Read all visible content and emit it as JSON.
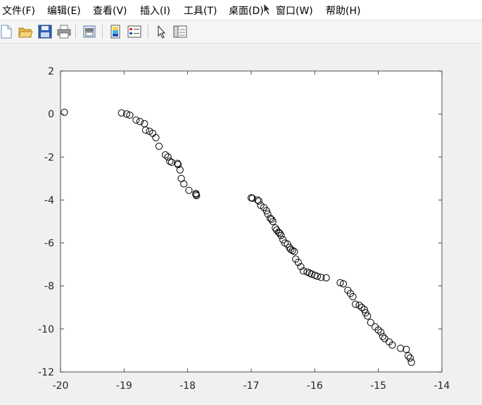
{
  "menubar": {
    "items": [
      {
        "label": "文件(F)"
      },
      {
        "label": "编辑(E)"
      },
      {
        "label": "查看(V)"
      },
      {
        "label": "插入(I)"
      },
      {
        "label": "工具(T)"
      },
      {
        "label": "桌面(D)"
      },
      {
        "label": "窗口(W)"
      },
      {
        "label": "帮助(H)"
      }
    ]
  },
  "toolbar": {
    "buttons": [
      {
        "icon": "new-figure-icon"
      },
      {
        "icon": "open-file-icon"
      },
      {
        "icon": "save-icon"
      },
      {
        "icon": "print-icon"
      },
      {
        "icon": "print-preview-icon"
      },
      {
        "icon": "insert-colorbar-icon"
      },
      {
        "icon": "insert-legend-icon"
      },
      {
        "icon": "edit-plot-arrow-icon"
      },
      {
        "icon": "property-inspector-icon"
      }
    ]
  },
  "chart_data": {
    "type": "scatter",
    "title": "",
    "xlabel": "",
    "ylabel": "",
    "xlim": [
      -20,
      -14
    ],
    "ylim": [
      -12,
      2
    ],
    "x_ticks": [
      "-20",
      "-19",
      "-18",
      "-17",
      "-16",
      "-15",
      "-14"
    ],
    "y_ticks": [
      "2",
      "0",
      "-2",
      "-4",
      "-6",
      "-8",
      "-10",
      "-12"
    ],
    "grid": false,
    "marker": "open-circle",
    "marker_color": "#000000",
    "series": [
      {
        "x": [
          -19.94,
          -19.04,
          -18.96,
          -18.91,
          -18.81,
          -18.75,
          -18.68,
          -18.66,
          -18.6,
          -18.55,
          -18.5,
          -18.45,
          -18.35,
          -18.31,
          -18.28,
          -18.25,
          -18.16,
          -18.15,
          -18.12,
          -18.1,
          -18.06,
          -17.98,
          -17.87,
          -17.87,
          -17.86
        ],
        "y": [
          0.08,
          0.05,
          0.0,
          -0.05,
          -0.28,
          -0.35,
          -0.45,
          -0.75,
          -0.8,
          -0.9,
          -1.1,
          -1.5,
          -1.9,
          -2.0,
          -2.2,
          -2.25,
          -2.3,
          -2.35,
          -2.6,
          -3.0,
          -3.25,
          -3.55,
          -3.7,
          -3.75,
          -3.8
        ]
      },
      {
        "x": [
          -17.0,
          -16.98,
          -16.9,
          -16.88,
          -16.85,
          -16.8,
          -16.76,
          -16.74,
          -16.7,
          -16.68,
          -16.66,
          -16.62,
          -16.6,
          -16.57,
          -16.55,
          -16.53,
          -16.5,
          -16.47,
          -16.43,
          -16.4,
          -16.38,
          -16.35,
          -16.32,
          -16.3,
          -16.26,
          -16.22,
          -16.18,
          -16.12,
          -16.08,
          -16.05,
          -16.0,
          -15.96,
          -15.9,
          -15.82
        ],
        "y": [
          -3.9,
          -3.92,
          -4.0,
          -4.05,
          -4.25,
          -4.35,
          -4.5,
          -4.65,
          -4.85,
          -4.9,
          -5.0,
          -5.3,
          -5.4,
          -5.5,
          -5.55,
          -5.65,
          -5.85,
          -6.0,
          -6.05,
          -6.2,
          -6.3,
          -6.35,
          -6.4,
          -6.75,
          -6.9,
          -7.1,
          -7.3,
          -7.35,
          -7.4,
          -7.45,
          -7.5,
          -7.55,
          -7.6,
          -7.62
        ]
      },
      {
        "x": [
          -15.6,
          -15.55,
          -15.48,
          -15.44,
          -15.4,
          -15.36,
          -15.3,
          -15.26,
          -15.22,
          -15.2,
          -15.17,
          -15.12,
          -15.05,
          -15.0,
          -14.96,
          -14.93,
          -14.9,
          -14.83,
          -14.78,
          -14.65,
          -14.56,
          -14.53,
          -14.5,
          -14.48
        ],
        "y": [
          -7.85,
          -7.9,
          -8.2,
          -8.35,
          -8.5,
          -8.85,
          -8.9,
          -9.0,
          -9.1,
          -9.25,
          -9.4,
          -9.7,
          -9.9,
          -10.05,
          -10.15,
          -10.35,
          -10.45,
          -10.6,
          -10.75,
          -10.9,
          -10.95,
          -11.25,
          -11.35,
          -11.55
        ]
      }
    ]
  }
}
